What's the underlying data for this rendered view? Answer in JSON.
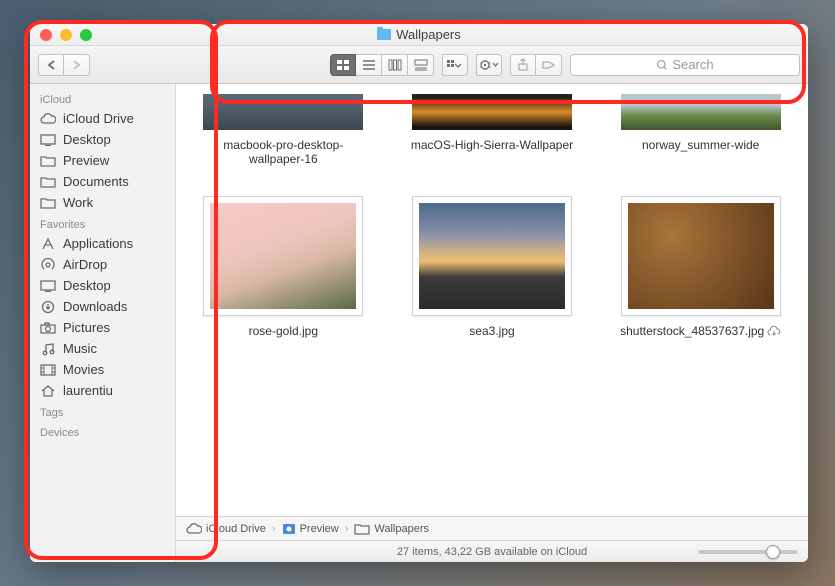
{
  "window": {
    "title": "Wallpapers"
  },
  "search": {
    "placeholder": "Search"
  },
  "sidebar": {
    "sections": [
      {
        "header": "iCloud",
        "items": [
          {
            "icon": "cloud-icon",
            "label": "iCloud Drive"
          },
          {
            "icon": "desktop-icon",
            "label": "Desktop"
          },
          {
            "icon": "folder-icon",
            "label": "Preview"
          },
          {
            "icon": "folder-icon",
            "label": "Documents"
          },
          {
            "icon": "folder-icon",
            "label": "Work"
          }
        ]
      },
      {
        "header": "Favorites",
        "items": [
          {
            "icon": "app-icon",
            "label": "Applications"
          },
          {
            "icon": "airdrop-icon",
            "label": "AirDrop"
          },
          {
            "icon": "desktop-icon",
            "label": "Desktop"
          },
          {
            "icon": "download-icon",
            "label": "Downloads"
          },
          {
            "icon": "camera-icon",
            "label": "Pictures"
          },
          {
            "icon": "music-icon",
            "label": "Music"
          },
          {
            "icon": "movie-icon",
            "label": "Movies"
          },
          {
            "icon": "home-icon",
            "label": "laurentiu"
          }
        ]
      },
      {
        "header": "Tags",
        "items": []
      },
      {
        "header": "Devices",
        "items": []
      }
    ]
  },
  "files": [
    {
      "name": "macbook-pro-desktop-wallpaper-16",
      "thumb": "t1",
      "partial": true,
      "cloud": false
    },
    {
      "name": "macOS-High-Sierra-Wallpaper",
      "thumb": "t2",
      "partial": true,
      "cloud": false
    },
    {
      "name": "norway_summer-wide",
      "thumb": "t3",
      "partial": true,
      "cloud": false
    },
    {
      "name": "rose-gold.jpg",
      "thumb": "t4",
      "partial": false,
      "cloud": false
    },
    {
      "name": "sea3.jpg",
      "thumb": "t5",
      "partial": false,
      "cloud": false
    },
    {
      "name": "shutterstock_48537637.jpg",
      "thumb": "t6",
      "partial": false,
      "cloud": true
    }
  ],
  "path": [
    {
      "icon": "cloud-icon",
      "label": "iCloud Drive"
    },
    {
      "icon": "preview-app-icon",
      "label": "Preview"
    },
    {
      "icon": "folder-icon",
      "label": "Wallpapers"
    }
  ],
  "status": "27 items, 43,22 GB available on iCloud"
}
